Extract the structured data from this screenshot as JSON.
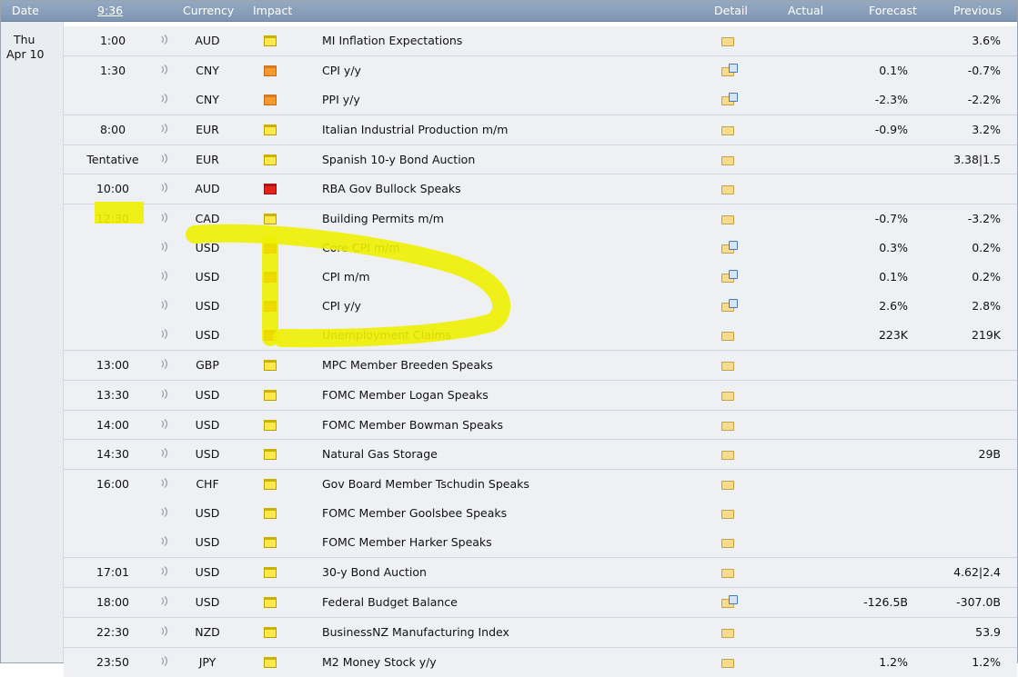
{
  "header": {
    "date": "Date",
    "time": "9:36",
    "currency": "Currency",
    "impact": "Impact",
    "detail": "Detail",
    "actual": "Actual",
    "forecast": "Forecast",
    "previous": "Previous"
  },
  "date": {
    "day": "Thu",
    "date": "Apr 10"
  },
  "rows": [
    {
      "time": "1:00",
      "currency": "AUD",
      "impact": "yellow",
      "title": "MI Inflation Expectations",
      "detail": "folder",
      "actual": "",
      "forecast": "",
      "previous": "3.6%"
    },
    {
      "time": "1:30",
      "currency": "CNY",
      "impact": "orange",
      "title": "CPI y/y",
      "detail": "folder-graph",
      "actual": "",
      "forecast": "0.1%",
      "previous": "-0.7%"
    },
    {
      "time": "",
      "currency": "CNY",
      "impact": "orange",
      "title": "PPI y/y",
      "detail": "folder-graph",
      "actual": "",
      "forecast": "-2.3%",
      "previous": "-2.2%"
    },
    {
      "time": "8:00",
      "currency": "EUR",
      "impact": "yellow",
      "title": "Italian Industrial Production m/m",
      "detail": "folder",
      "actual": "",
      "forecast": "-0.9%",
      "previous": "3.2%"
    },
    {
      "time": "Tentative",
      "currency": "EUR",
      "impact": "yellow",
      "title": "Spanish 10-y Bond Auction",
      "detail": "folder",
      "actual": "",
      "forecast": "",
      "previous": "3.38|1.5"
    },
    {
      "time": "10:00",
      "currency": "AUD",
      "impact": "red",
      "title": "RBA Gov Bullock Speaks",
      "detail": "folder",
      "actual": "",
      "forecast": "",
      "previous": ""
    },
    {
      "time": "12:30",
      "currency": "CAD",
      "impact": "yellow",
      "title": "Building Permits m/m",
      "detail": "folder",
      "actual": "",
      "forecast": "-0.7%",
      "previous": "-3.2%"
    },
    {
      "time": "",
      "currency": "USD",
      "impact": "red",
      "title": "Core CPI m/m",
      "detail": "folder-graph",
      "actual": "",
      "forecast": "0.3%",
      "previous": "0.2%"
    },
    {
      "time": "",
      "currency": "USD",
      "impact": "red",
      "title": "CPI m/m",
      "detail": "folder-graph",
      "actual": "",
      "forecast": "0.1%",
      "previous": "0.2%"
    },
    {
      "time": "",
      "currency": "USD",
      "impact": "red",
      "title": "CPI y/y",
      "detail": "folder-graph",
      "actual": "",
      "forecast": "2.6%",
      "previous": "2.8%"
    },
    {
      "time": "",
      "currency": "USD",
      "impact": "red",
      "title": "Unemployment Claims",
      "detail": "folder",
      "actual": "",
      "forecast": "223K",
      "previous": "219K"
    },
    {
      "time": "13:00",
      "currency": "GBP",
      "impact": "yellow",
      "title": "MPC Member Breeden Speaks",
      "detail": "folder",
      "actual": "",
      "forecast": "",
      "previous": ""
    },
    {
      "time": "13:30",
      "currency": "USD",
      "impact": "yellow",
      "title": "FOMC Member Logan Speaks",
      "detail": "folder",
      "actual": "",
      "forecast": "",
      "previous": ""
    },
    {
      "time": "14:00",
      "currency": "USD",
      "impact": "yellow",
      "title": "FOMC Member Bowman Speaks",
      "detail": "folder",
      "actual": "",
      "forecast": "",
      "previous": ""
    },
    {
      "time": "14:30",
      "currency": "USD",
      "impact": "yellow",
      "title": "Natural Gas Storage",
      "detail": "folder",
      "actual": "",
      "forecast": "",
      "previous": "29B"
    },
    {
      "time": "16:00",
      "currency": "CHF",
      "impact": "yellow",
      "title": "Gov Board Member Tschudin Speaks",
      "detail": "folder",
      "actual": "",
      "forecast": "",
      "previous": ""
    },
    {
      "time": "",
      "currency": "USD",
      "impact": "yellow",
      "title": "FOMC Member Goolsbee Speaks",
      "detail": "folder",
      "actual": "",
      "forecast": "",
      "previous": ""
    },
    {
      "time": "",
      "currency": "USD",
      "impact": "yellow",
      "title": "FOMC Member Harker Speaks",
      "detail": "folder",
      "actual": "",
      "forecast": "",
      "previous": ""
    },
    {
      "time": "17:01",
      "currency": "USD",
      "impact": "yellow",
      "title": "30-y Bond Auction",
      "detail": "folder",
      "actual": "",
      "forecast": "",
      "previous": "4.62|2.4"
    },
    {
      "time": "18:00",
      "currency": "USD",
      "impact": "yellow",
      "title": "Federal Budget Balance",
      "detail": "folder-graph",
      "actual": "",
      "forecast": "-126.5B",
      "previous": "-307.0B"
    },
    {
      "time": "22:30",
      "currency": "NZD",
      "impact": "yellow",
      "title": "BusinessNZ Manufacturing Index",
      "detail": "folder",
      "actual": "",
      "forecast": "",
      "previous": "53.9"
    },
    {
      "time": "23:50",
      "currency": "JPY",
      "impact": "yellow",
      "title": "M2 Money Stock y/y",
      "detail": "folder",
      "actual": "",
      "forecast": "1.2%",
      "previous": "1.2%"
    }
  ],
  "colors": {
    "header_bg": "#8ba0bb",
    "row_bg": "#eef0f4",
    "date_col_bg": "#e9ecf1",
    "highlight": "#eef000",
    "impact_yellow": "#ffe94a",
    "impact_orange": "#f79a2e",
    "impact_red": "#e3221a"
  }
}
